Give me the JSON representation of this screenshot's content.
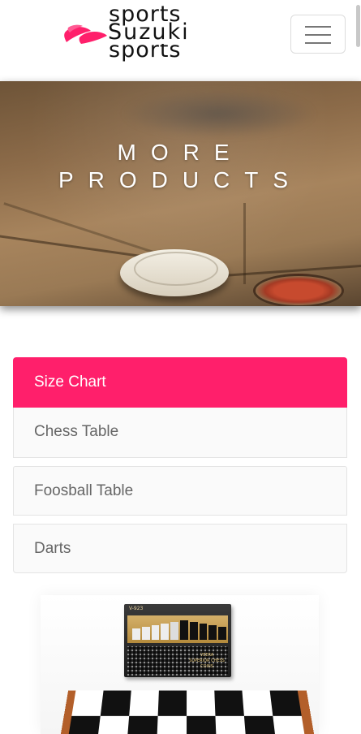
{
  "header": {
    "logo": {
      "brand_top": "sports",
      "brand_name": "Suzuki",
      "brand_bottom": "sports",
      "accent_color": "#ff1f6b"
    },
    "menu_button": {
      "icon": "hamburger-icon"
    }
  },
  "hero": {
    "title_line1": "MORE",
    "title_line2": "PRODUCTS"
  },
  "categories": {
    "active_color": "#ff1f6b",
    "items": [
      {
        "label": "Size Chart",
        "active": true
      },
      {
        "label": "Chess Table",
        "active": false
      },
      {
        "label": "Foosball Table",
        "active": false
      },
      {
        "label": "Darts",
        "active": false
      }
    ]
  },
  "product": {
    "box_code": "V-923",
    "box_title_line1": "VEERA",
    "box_title_line2": "SUPERIOR CHESS",
    "box_title_line3": "COINS"
  }
}
